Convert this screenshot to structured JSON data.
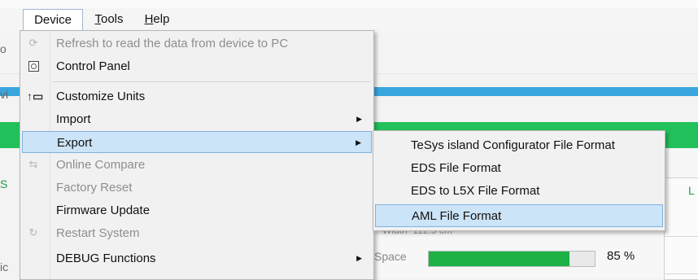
{
  "menubar": {
    "device": "Device",
    "tools_first": "T",
    "tools_rest": "ools",
    "help_first": "H",
    "help_rest": "elp"
  },
  "device_menu": {
    "items": [
      {
        "label": "Refresh to read the data from device to PC",
        "icon": "refresh-icon",
        "enabled": false
      },
      {
        "label": "Control Panel",
        "icon": "control-panel-icon",
        "enabled": true
      },
      {
        "label": "Customize Units",
        "icon": "units-icon",
        "enabled": true
      },
      {
        "label": "Import",
        "enabled": true,
        "submenu": true
      },
      {
        "label": "Export",
        "enabled": true,
        "submenu": true,
        "highlighted": true
      },
      {
        "label": "Online Compare",
        "icon": "compare-icon",
        "enabled": false
      },
      {
        "label": "Factory Reset",
        "enabled": false
      },
      {
        "label": "Firmware Update",
        "enabled": true
      },
      {
        "label": "Restart System",
        "icon": "restart-icon",
        "enabled": false
      },
      {
        "label": "DEBUG Functions",
        "enabled": true,
        "submenu": true
      }
    ]
  },
  "export_submenu": {
    "items": [
      {
        "label": "TeSys island Configurator File Format"
      },
      {
        "label": "EDS File Format"
      },
      {
        "label": "EDS to L5X File Format"
      },
      {
        "label": "AML File Format",
        "highlighted": true
      }
    ]
  },
  "background": {
    "space_label": "Space",
    "width_label": "Width",
    "width_value": "112.5 cm",
    "progress_text": "85 %",
    "progress": 0.85,
    "left_fragments": [
      "o",
      "vi",
      "S",
      "ic"
    ],
    "right_fragment": "L"
  },
  "colors": {
    "highlight_bg": "#cce4f7",
    "highlight_border": "#7fb2e0",
    "green_bar": "#22c05a",
    "blue_bar": "#3aa6de",
    "progress_fill": "#1db146"
  }
}
